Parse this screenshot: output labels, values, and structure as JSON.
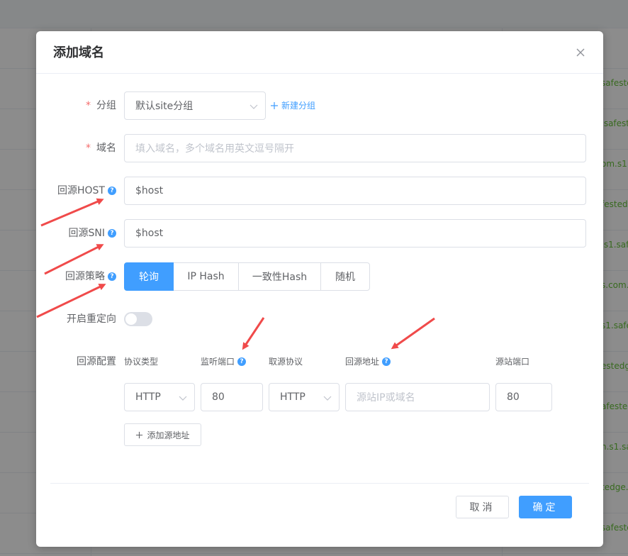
{
  "background": {
    "right_cells": [
      "safeste",
      ".safest",
      "om.s1.",
      "fested.",
      ".s1.saf",
      "s.com.",
      "s1.safe",
      "estedg",
      "afested",
      "n.s1.sa",
      "tedge.",
      "safeste"
    ]
  },
  "dialog": {
    "title": "添加域名",
    "close_icon": "close-icon"
  },
  "form": {
    "group": {
      "label": "分组",
      "required_mark": "*",
      "value": "默认site分组",
      "new_group_label": "新建分组"
    },
    "domain": {
      "label": "域名",
      "required_mark": "*",
      "placeholder": "填入域名，多个域名用英文逗号隔开"
    },
    "origin_host": {
      "label": "回源HOST",
      "value": "$host"
    },
    "origin_sni": {
      "label": "回源SNI",
      "value": "$host"
    },
    "origin_strategy": {
      "label": "回源策略",
      "options": [
        "轮询",
        "IP Hash",
        "一致性Hash",
        "随机"
      ],
      "selected": "轮询"
    },
    "redirect": {
      "label": "开启重定向",
      "enabled": false
    },
    "origin_config": {
      "label": "回源配置",
      "columns": [
        "协议类型",
        "监听端口",
        "取源协议",
        "回源地址",
        "源站端口"
      ],
      "row": {
        "protocol": "HTTP",
        "listen_port": "80",
        "fetch_protocol": "HTTP",
        "address_placeholder": "源站IP或域名",
        "origin_port": "80"
      },
      "add_label": "添加源地址"
    }
  },
  "footer": {
    "cancel_label": "取消",
    "ok_label": "确定"
  },
  "colors": {
    "primary": "#409eff",
    "required": "#f56c6c",
    "annotation_arrow": "#f04a4a"
  }
}
